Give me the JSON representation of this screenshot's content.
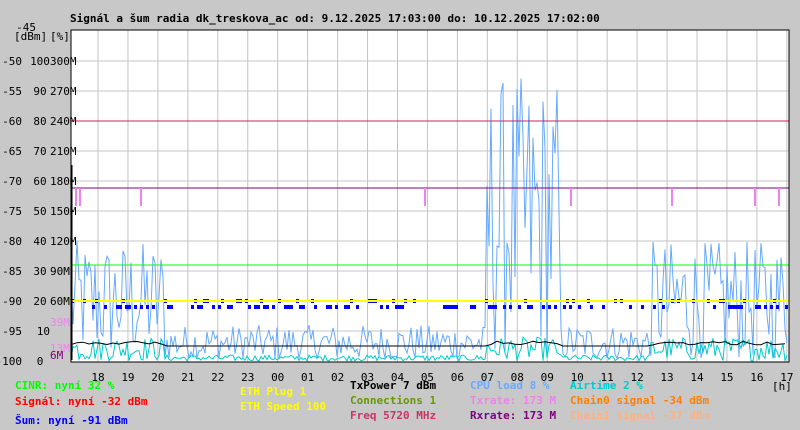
{
  "chart_data": {
    "type": "line",
    "title": "Signál a šum radia dk_treskova_ac od: 9.12.2025 17:03:00 do: 10.12.2025 17:02:00",
    "x_unit": "[h]",
    "x_ticks": [
      "18",
      "19",
      "20",
      "21",
      "22",
      "23",
      "00",
      "01",
      "02",
      "03",
      "04",
      "05",
      "06",
      "07",
      "08",
      "09",
      "10",
      "11",
      "12",
      "13",
      "14",
      "15",
      "16",
      "17"
    ],
    "y_units": [
      "[dBm]",
      "[%]"
    ],
    "y_range_dbm": [
      -100,
      -45
    ],
    "y_ticks_dbm": [
      "-45",
      "-50",
      "-55",
      "-60",
      "-65",
      "-70",
      "-75",
      "-80",
      "-85",
      "-90",
      "-95",
      "-100"
    ],
    "y_ticks_pct": [
      "",
      "100",
      "90",
      "80",
      "70",
      "60",
      "50",
      "40",
      "30",
      "20",
      "10",
      "0"
    ],
    "y_ticks_rate": [
      "",
      "300M",
      "270M",
      "240M",
      "210M",
      "180M",
      "150M",
      "120M",
      "90M",
      "60M",
      "",
      "",
      ""
    ],
    "extra_rate_ticks": [
      {
        "label": "39M",
        "value": 39,
        "color": "#ee82ee"
      },
      {
        "label": "13M",
        "value": 13,
        "color": "#ee82ee"
      },
      {
        "label": "6M",
        "value": 6,
        "color": "#800080"
      }
    ],
    "grid": true,
    "series": [
      {
        "name": "CINR",
        "unit": "%",
        "level": 32,
        "color": "#00ff00"
      },
      {
        "name": "Signal",
        "unit": "dBm",
        "level": -60,
        "color": "#d02060"
      },
      {
        "name": "Noise",
        "unit": "dBm",
        "level": -91,
        "color": "#0000ff"
      },
      {
        "name": "ETH Speed",
        "unit": "%",
        "level": 20,
        "color": "#ffff00"
      },
      {
        "name": "Rxrate",
        "unit": "M",
        "level": 173,
        "color": "#800080"
      },
      {
        "name": "Txrate",
        "unit": "M",
        "level": 173,
        "color": "#ee82ee"
      },
      {
        "name": "CPU load",
        "unit": "%",
        "level": 8,
        "color": "#66aaff"
      },
      {
        "name": "Airtime",
        "unit": "%",
        "level": 2,
        "color": "#00cccc"
      },
      {
        "name": "TxPower",
        "unit": "dBm",
        "level": -97,
        "color": "#000000"
      }
    ]
  },
  "legend": {
    "cinr": {
      "text": "CINR: nyní 32 %",
      "color": "#00ff00"
    },
    "signal": {
      "text": "Signál: nyní -32 dBm",
      "color": "#ff0000"
    },
    "noise": {
      "text": "Šum: nyní -91 dBm",
      "color": "#0000ff"
    },
    "eth_plug": {
      "text": "ETH Plug 1",
      "color": "#ffff00"
    },
    "eth_speed": {
      "text": "ETH Speed 100",
      "color": "#ffff00"
    },
    "txpower": {
      "text": "TxPower 7 dBm",
      "color": "#000000"
    },
    "connections": {
      "text": "Connections 1",
      "color": "#669900"
    },
    "freq": {
      "text": "Freq 5720 MHz",
      "color": "#cc3366"
    },
    "cpu": {
      "text": "CPU load 8 %",
      "color": "#66aaff"
    },
    "txrate": {
      "text": "Txrate: 173 M",
      "color": "#ee82ee"
    },
    "rxrate": {
      "text": "Rxrate: 173 M",
      "color": "#800080"
    },
    "airtime": {
      "text": "Airtime 2 %",
      "color": "#00cccc"
    },
    "chain0": {
      "text": "Chain0 signal -34 dBm",
      "color": "#ff8000"
    },
    "chain1": {
      "text": "Chain1 signal -37 dBm",
      "color": "#ffb080"
    }
  }
}
